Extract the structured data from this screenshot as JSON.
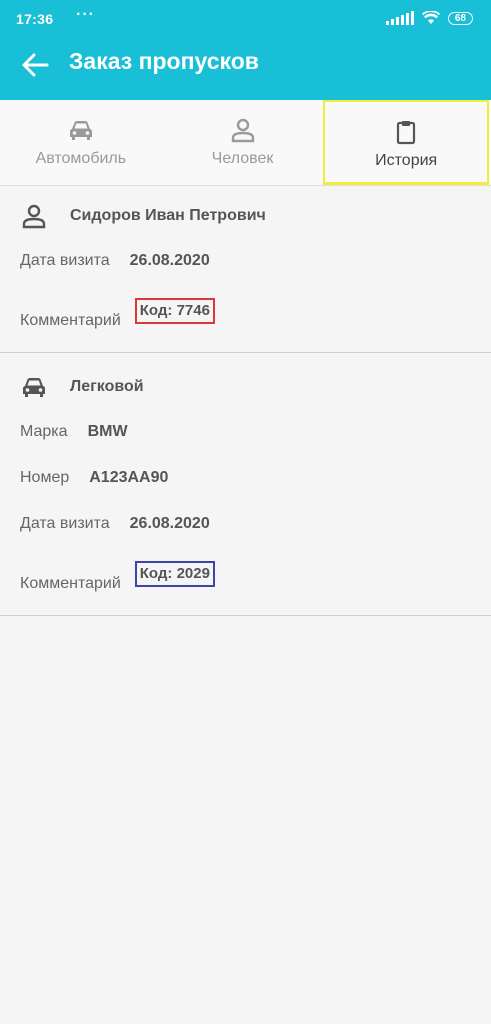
{
  "status": {
    "time": "17:36",
    "dots": "···",
    "battery": "68"
  },
  "header": {
    "title": "Заказ пропусков"
  },
  "tabs": [
    {
      "label": "Автомобиль",
      "icon": "car-icon"
    },
    {
      "label": "Человек",
      "icon": "person-icon"
    },
    {
      "label": "История",
      "icon": "clipboard-icon",
      "active": true
    }
  ],
  "cards": {
    "person": {
      "name": "Сидоров Иван Петрович",
      "date_label": "Дата визита",
      "date_value": "26.08.2020",
      "comment_label": "Комментарий",
      "comment_value": "Код: 7746"
    },
    "vehicle": {
      "type": "Легковой",
      "brand_label": "Марка",
      "brand_value": "BMW",
      "plate_label": "Номер",
      "plate_value": "А123АА90",
      "date_label": "Дата визита",
      "date_value": "26.08.2020",
      "comment_label": "Комментарий",
      "comment_value": "Код: 2029"
    }
  },
  "colors": {
    "appbar": "#19bfd6",
    "active_tab_outline": "#f2ee3c",
    "code_red_outline": "#d83a3a",
    "code_blue_outline": "#3c45a8"
  }
}
